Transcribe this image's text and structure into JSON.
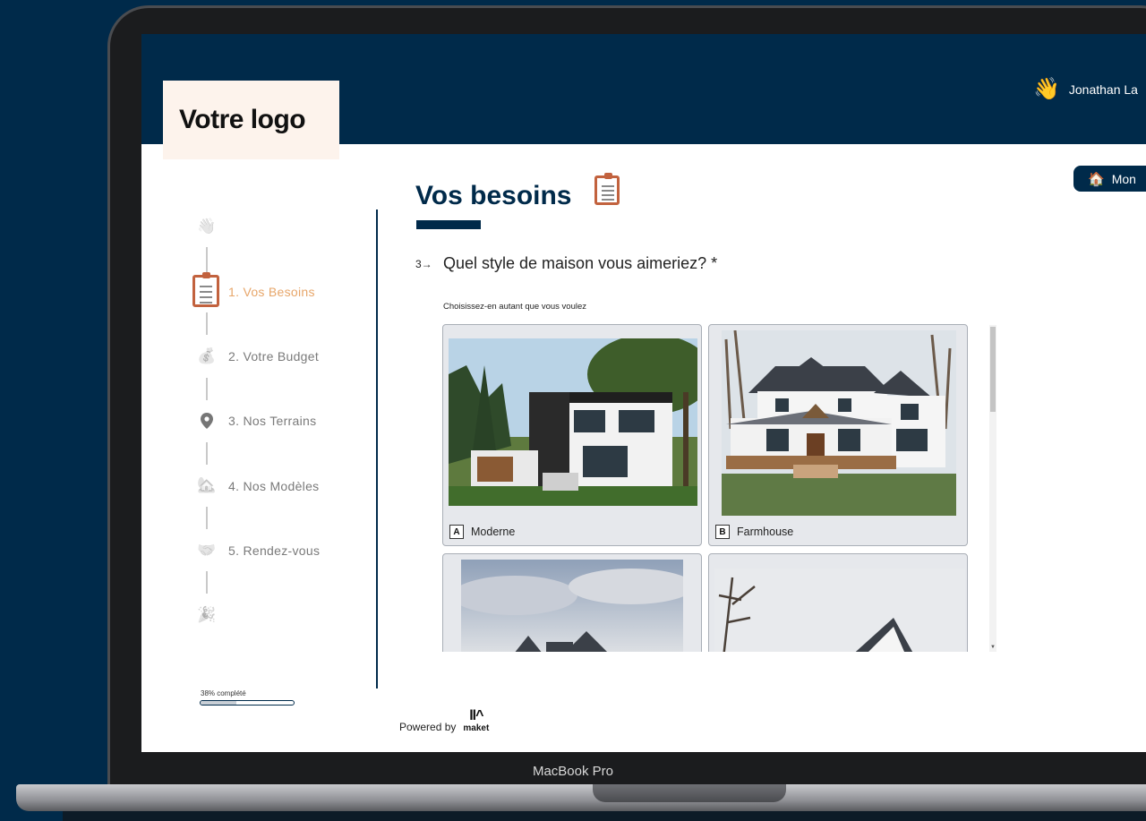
{
  "device": {
    "label": "MacBook Pro"
  },
  "header": {
    "logo_text": "Votre logo",
    "user_emoji": "👋",
    "user_name": "Jonathan La",
    "home_pill_label": "Mon",
    "home_pill_icon": "🏠"
  },
  "sidebar": {
    "steps": [
      {
        "icon": "waving-hand-icon",
        "label": ""
      },
      {
        "icon": "clipboard-icon",
        "label": "1. Vos Besoins",
        "active": true
      },
      {
        "icon": "money-bag-icon",
        "label": "2. Votre Budget"
      },
      {
        "icon": "location-pin-icon",
        "label": "3. Nos Terrains"
      },
      {
        "icon": "house-icon",
        "label": "4. Nos Modèles"
      },
      {
        "icon": "handshake-icon",
        "label": "5. Rendez-vous"
      },
      {
        "icon": "party-popper-icon",
        "label": ""
      }
    ],
    "progress_text": "38% complété",
    "progress_fraction": 0.38
  },
  "main": {
    "title": "Vos besoins",
    "question_number": "3→",
    "question": "Quel style de maison vous aimeriez? *",
    "hint": "Choisissez-en autant que vous voulez",
    "choices": [
      {
        "key": "A",
        "label": "Moderne"
      },
      {
        "key": "B",
        "label": "Farmhouse"
      }
    ]
  },
  "footer": {
    "powered_by": "Powered by",
    "brand_mark": "ll^",
    "brand": "maket"
  },
  "colors": {
    "navy": "#002a4a",
    "accent": "#e7a66a",
    "logo_bg": "#fdf3ec"
  }
}
